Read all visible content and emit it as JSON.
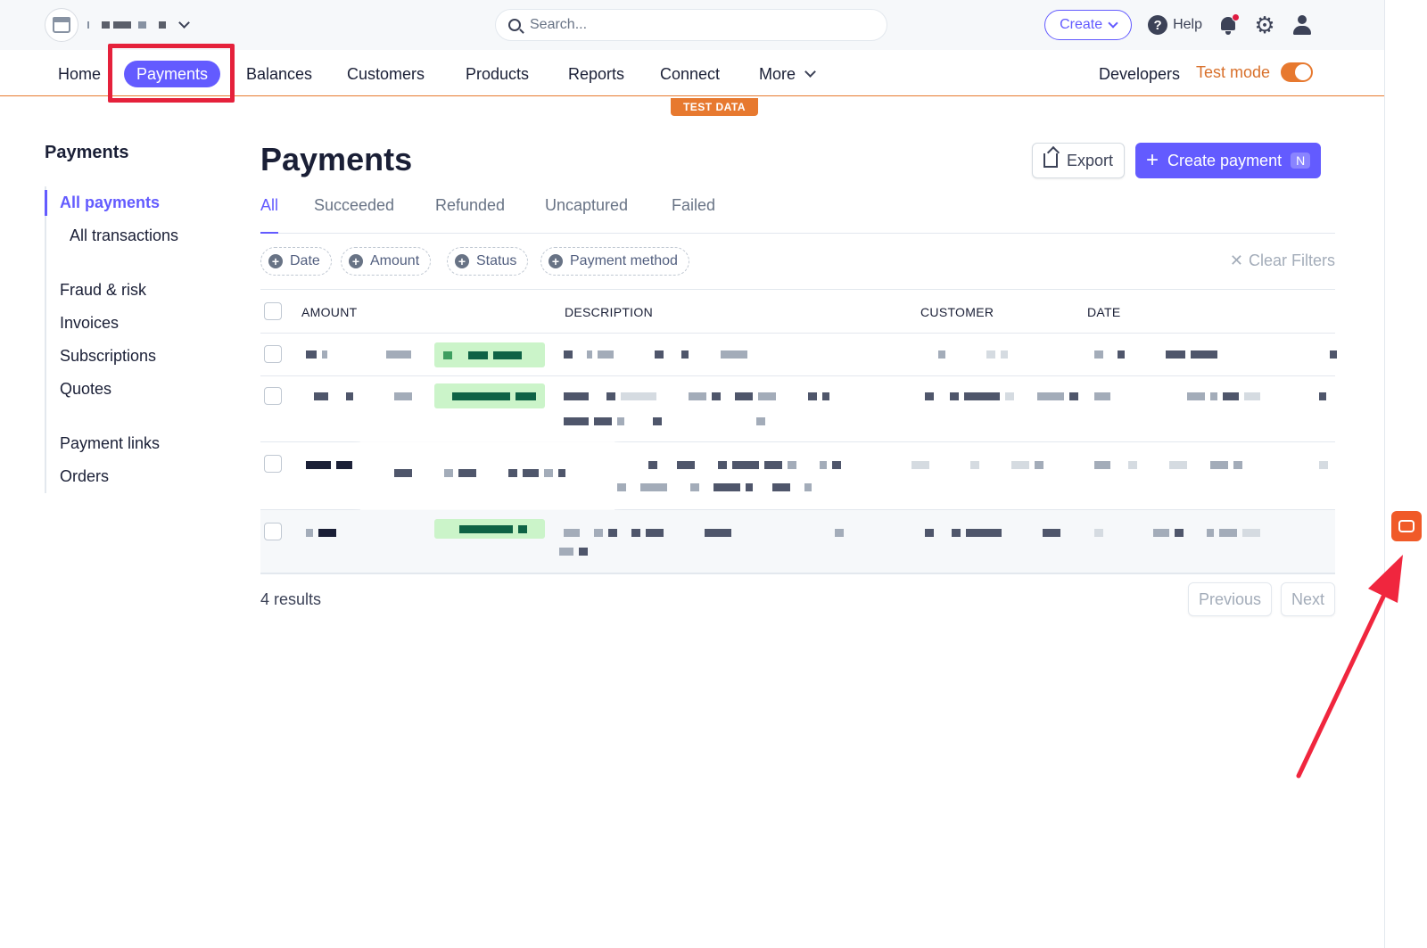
{
  "topbar": {
    "search_placeholder": "Search...",
    "create_label": "Create",
    "help_label": "Help"
  },
  "nav": {
    "items": [
      "Home",
      "Payments",
      "Balances",
      "Customers",
      "Products",
      "Reports",
      "Connect",
      "More"
    ],
    "developers_label": "Developers",
    "test_mode_label": "Test mode",
    "test_data_badge": "TEST DATA"
  },
  "sidebar": {
    "title": "Payments",
    "items": [
      "All payments",
      "All transactions",
      "Fraud & risk",
      "Invoices",
      "Subscriptions",
      "Quotes",
      "Payment links",
      "Orders"
    ]
  },
  "main": {
    "title": "Payments",
    "export_label": "Export",
    "create_payment_label": "Create payment",
    "create_payment_shortcut": "N",
    "tabs": [
      "All",
      "Succeeded",
      "Refunded",
      "Uncaptured",
      "Failed"
    ],
    "filters": [
      "Date",
      "Amount",
      "Status",
      "Payment method"
    ],
    "clear_filters_label": "Clear Filters",
    "columns": [
      "AMOUNT",
      "DESCRIPTION",
      "CUSTOMER",
      "DATE"
    ],
    "results_text": "4 results",
    "previous_label": "Previous",
    "next_label": "Next"
  },
  "colors": {
    "accent": "#635bff",
    "test_mode": "#e7792f",
    "highlight": "#e5213b"
  },
  "icons": [
    "store-icon",
    "chevron-down-icon",
    "search-icon",
    "help-icon",
    "bell-icon",
    "gear-icon",
    "user-icon",
    "export-icon",
    "plus-icon",
    "close-icon",
    "widget-icon"
  ]
}
